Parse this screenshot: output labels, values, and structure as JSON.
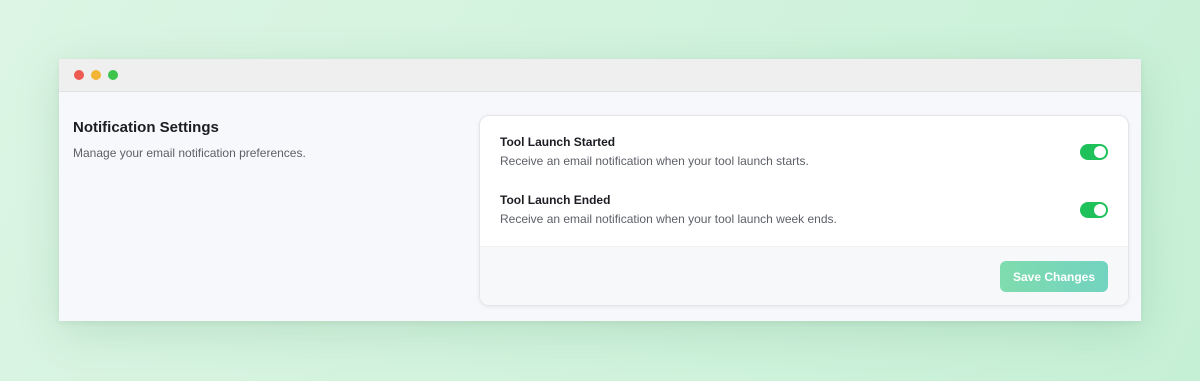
{
  "window": {
    "controls": [
      "close",
      "minimize",
      "maximize"
    ]
  },
  "section": {
    "title": "Notification Settings",
    "description": "Manage your email notification preferences."
  },
  "settings": [
    {
      "label": "Tool Launch Started",
      "description": "Receive an email notification when your tool launch starts.",
      "enabled": true
    },
    {
      "label": "Tool Launch Ended",
      "description": "Receive an email notification when your tool launch week ends.",
      "enabled": true
    }
  ],
  "footer": {
    "save_label": "Save Changes"
  },
  "colors": {
    "toggle_on": "#1fc25a",
    "save_button_start": "#7fdcae",
    "save_button_end": "#72d3c0",
    "close_dot": "#ee5b52",
    "minimize_dot": "#f2b434",
    "maximize_dot": "#3cc44d"
  }
}
